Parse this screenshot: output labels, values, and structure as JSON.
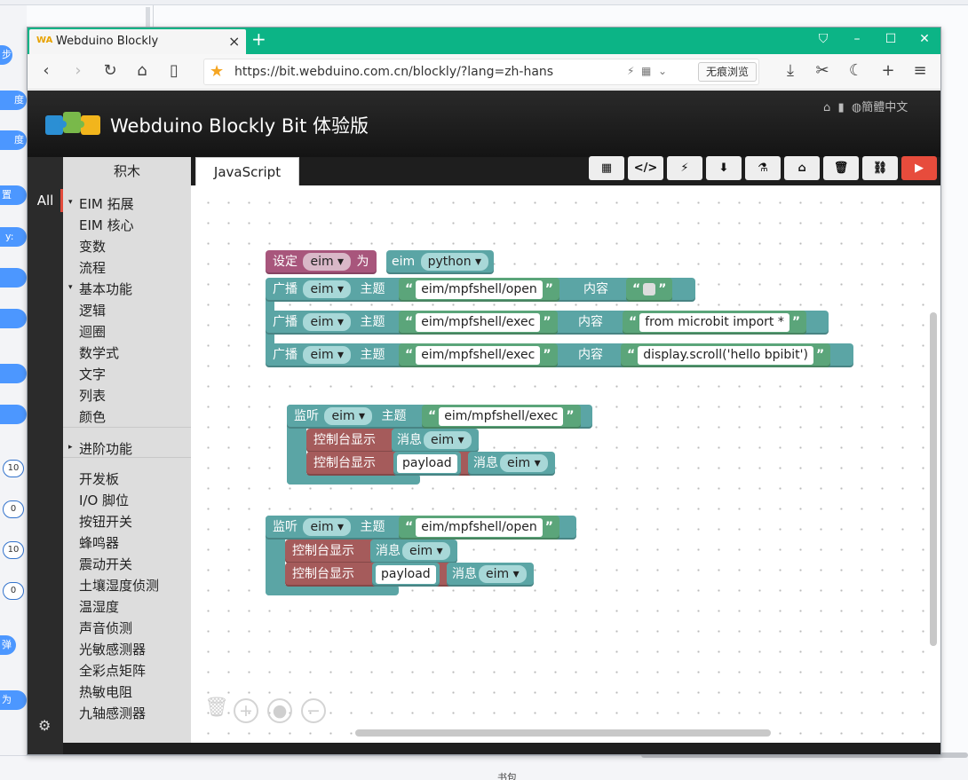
{
  "background_app": {
    "left_items": [
      "步",
      "度",
      "度",
      "置",
      "y:",
      "10",
      "0",
      "10",
      "0",
      "弹",
      "为"
    ],
    "bottom_text": "书包"
  },
  "browser": {
    "tab_title": "Webduino Blockly",
    "tab_logo": "WA",
    "url": "https://bit.webduino.com.cn/blockly/?lang=zh-hans",
    "incognito_label": "无痕浏览",
    "accent": "#0cb486"
  },
  "app": {
    "title": "Webduino Blockly Bit 体验版",
    "header_links": "簡體中文",
    "tabs": {
      "blocks": "积木",
      "js": "JavaScript"
    },
    "toolbox_all": "All",
    "toolbox": [
      {
        "label": "EIM 拓展",
        "arrow": "▾"
      },
      {
        "label": "EIM 核心",
        "arrow": ""
      },
      {
        "label": "变数",
        "arrow": ""
      },
      {
        "label": "流程",
        "arrow": ""
      },
      {
        "label": "基本功能",
        "arrow": "▾"
      },
      {
        "label": "逻辑",
        "arrow": ""
      },
      {
        "label": "迴圈",
        "arrow": ""
      },
      {
        "label": "数学式",
        "arrow": ""
      },
      {
        "label": "文字",
        "arrow": ""
      },
      {
        "label": "列表",
        "arrow": ""
      },
      {
        "label": "颜色",
        "arrow": ""
      },
      {
        "label": "进阶功能",
        "arrow": "▸"
      },
      {
        "label": "开发板",
        "arrow": ""
      },
      {
        "label": "I/O 脚位",
        "arrow": ""
      },
      {
        "label": "按钮开关",
        "arrow": ""
      },
      {
        "label": "蜂鸣器",
        "arrow": ""
      },
      {
        "label": "震动开关",
        "arrow": ""
      },
      {
        "label": "土壤湿度侦测",
        "arrow": ""
      },
      {
        "label": "温湿度",
        "arrow": ""
      },
      {
        "label": "声音侦测",
        "arrow": ""
      },
      {
        "label": "光敏感测器",
        "arrow": ""
      },
      {
        "label": "全彩点矩阵",
        "arrow": ""
      },
      {
        "label": "热敏电阻",
        "arrow": ""
      },
      {
        "label": "九轴感测器",
        "arrow": ""
      }
    ],
    "toolbar_icons": [
      "qr-icon",
      "code-icon",
      "flash-icon",
      "download-icon",
      "flask-icon",
      "library-icon",
      "trash-icon",
      "link-icon",
      "run-icon"
    ],
    "run_color": "#e74c3c"
  },
  "blocks": {
    "set": {
      "label": "设定",
      "var": "eim",
      "as": "为",
      "value_label": "eim",
      "value": "python"
    },
    "broadcast": [
      {
        "label": "广播",
        "var": "eim",
        "topic_label": "主题",
        "topic": "eim/mpfshell/open",
        "content_label": "内容",
        "content": ""
      },
      {
        "label": "广播",
        "var": "eim",
        "topic_label": "主题",
        "topic": "eim/mpfshell/exec",
        "content_label": "内容",
        "content": "from microbit import *"
      },
      {
        "label": "广播",
        "var": "eim",
        "topic_label": "主题",
        "topic": "eim/mpfshell/exec",
        "content_label": "内容",
        "content": "display.scroll('hello bpibit')"
      }
    ],
    "listen1": {
      "label": "监听",
      "var": "eim",
      "topic_label": "主题",
      "topic": "eim/mpfshell/exec",
      "log1": {
        "label": "控制台显示",
        "msg_label": "消息",
        "var": "eim"
      },
      "log2": {
        "label": "控制台显示",
        "payload": "payload",
        "msg_label": "消息",
        "var": "eim"
      }
    },
    "listen2": {
      "label": "监听",
      "var": "eim",
      "topic_label": "主题",
      "topic": "eim/mpfshell/open",
      "log1": {
        "label": "控制台显示",
        "msg_label": "消息",
        "var": "eim"
      },
      "log2": {
        "label": "控制台显示",
        "payload": "payload",
        "msg_label": "消息",
        "var": "eim"
      }
    }
  }
}
